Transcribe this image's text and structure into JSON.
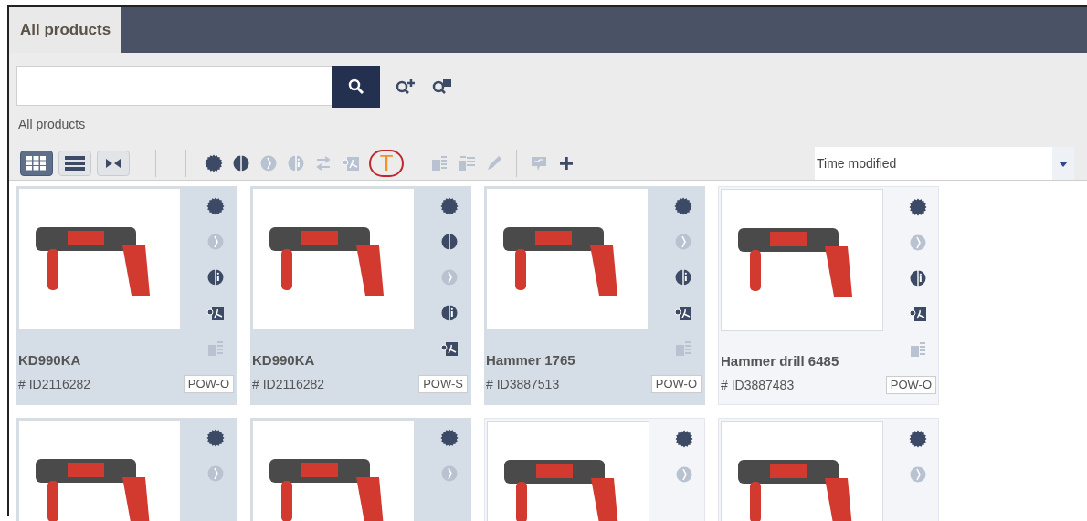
{
  "tabs": [
    {
      "label": "All products",
      "selected": true
    }
  ],
  "scope_label": "All products",
  "view_buttons": [
    {
      "kind": "grid",
      "selected": true
    },
    {
      "kind": "list",
      "selected": false
    },
    {
      "kind": "split",
      "selected": false
    }
  ],
  "toolbar_groups": [
    [
      {
        "kind": "seal",
        "disabled": false
      },
      {
        "kind": "half",
        "disabled": false
      },
      {
        "kind": "compare",
        "disabled": true
      },
      {
        "kind": "info",
        "disabled": true
      },
      {
        "kind": "swap",
        "disabled": true
      },
      {
        "kind": "pdf",
        "disabled": true
      },
      {
        "kind": "text",
        "label": "T",
        "disabled": false,
        "circled": true
      }
    ],
    [
      {
        "kind": "doc",
        "disabled": true
      },
      {
        "kind": "docs",
        "disabled": true
      },
      {
        "kind": "pencil",
        "disabled": true
      }
    ],
    [
      {
        "kind": "comment",
        "disabled": true
      },
      {
        "kind": "plus",
        "disabled": false
      }
    ]
  ],
  "sort": {
    "value": "Time modified"
  },
  "products": [
    {
      "name": "KD990KA",
      "id": "# ID2116282",
      "tag": "POW-O",
      "selected": true,
      "icons": [
        {
          "kind": "seal",
          "disabled": false
        },
        {
          "kind": "compare",
          "disabled": true
        },
        {
          "kind": "info",
          "disabled": false
        },
        {
          "kind": "pdf",
          "disabled": false
        },
        {
          "kind": "doc",
          "disabled": true
        }
      ]
    },
    {
      "name": "KD990KA",
      "id": "# ID2116282",
      "tag": "POW-S",
      "selected": true,
      "icons": [
        {
          "kind": "seal",
          "disabled": false
        },
        {
          "kind": "half",
          "disabled": false
        },
        {
          "kind": "compare",
          "disabled": true
        },
        {
          "kind": "info",
          "disabled": false
        },
        {
          "kind": "pdf",
          "disabled": false
        }
      ]
    },
    {
      "name": "Hammer 1765",
      "id": "# ID3887513",
      "tag": "POW-O",
      "selected": true,
      "icons": [
        {
          "kind": "seal",
          "disabled": false
        },
        {
          "kind": "compare",
          "disabled": true
        },
        {
          "kind": "info",
          "disabled": false
        },
        {
          "kind": "pdf",
          "disabled": false
        },
        {
          "kind": "doc",
          "disabled": true
        }
      ]
    },
    {
      "name": "Hammer drill 6485",
      "id": "# ID3887483",
      "tag": "POW-O",
      "selected": false,
      "icons": [
        {
          "kind": "seal",
          "disabled": false
        },
        {
          "kind": "compare",
          "disabled": true
        },
        {
          "kind": "info",
          "disabled": false
        },
        {
          "kind": "pdf",
          "disabled": false
        },
        {
          "kind": "doc",
          "disabled": true
        }
      ]
    },
    {
      "selected": true,
      "icons": [
        {
          "kind": "seal",
          "disabled": false
        },
        {
          "kind": "compare",
          "disabled": true
        }
      ]
    },
    {
      "selected": true,
      "icons": [
        {
          "kind": "seal",
          "disabled": false
        },
        {
          "kind": "compare",
          "disabled": true
        }
      ]
    },
    {
      "selected": false,
      "icons": [
        {
          "kind": "seal",
          "disabled": false
        },
        {
          "kind": "compare",
          "disabled": true
        }
      ]
    },
    {
      "selected": false,
      "icons": [
        {
          "kind": "seal",
          "disabled": false
        },
        {
          "kind": "compare",
          "disabled": true
        }
      ]
    }
  ]
}
